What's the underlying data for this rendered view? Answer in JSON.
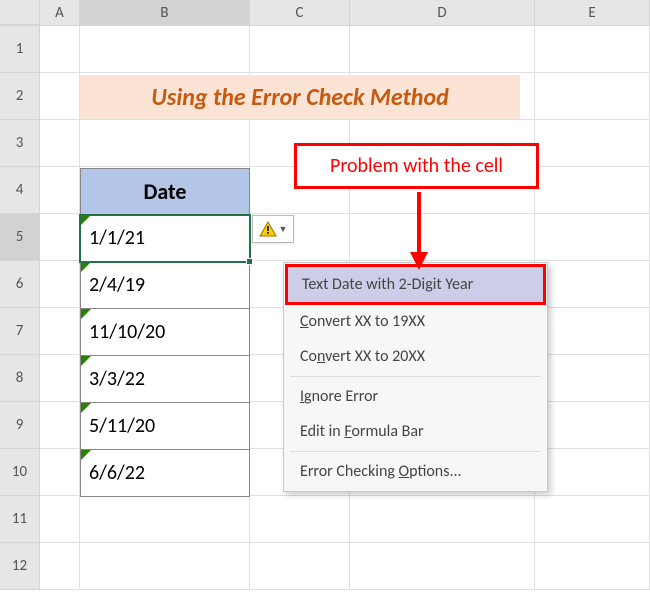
{
  "columns": [
    "A",
    "B",
    "C",
    "D",
    "E"
  ],
  "rows": [
    "1",
    "2",
    "3",
    "4",
    "5",
    "6",
    "7",
    "8",
    "9",
    "10",
    "11",
    "12"
  ],
  "title": "Using the Error Check Method",
  "callout": "Problem with the cell",
  "table": {
    "header": "Date",
    "cells": [
      "1/1/21",
      "2/4/19",
      "11/10/20",
      "3/3/22",
      "5/11/20",
      "6/6/22"
    ]
  },
  "active_cell": "B5",
  "menu": {
    "header": "Text Date with 2-Digit Year",
    "convert19": "Convert XX to 19XX",
    "convert20": "Convert XX to 20XX",
    "ignore": "Ignore Error",
    "edit": "Edit in Formula Bar",
    "options": "Error Checking Options..."
  },
  "chart_data": {
    "type": "table",
    "title": "Date",
    "categories": [
      "Date"
    ],
    "values": [
      "1/1/21",
      "2/4/19",
      "11/10/20",
      "3/3/22",
      "5/11/20",
      "6/6/22"
    ]
  }
}
